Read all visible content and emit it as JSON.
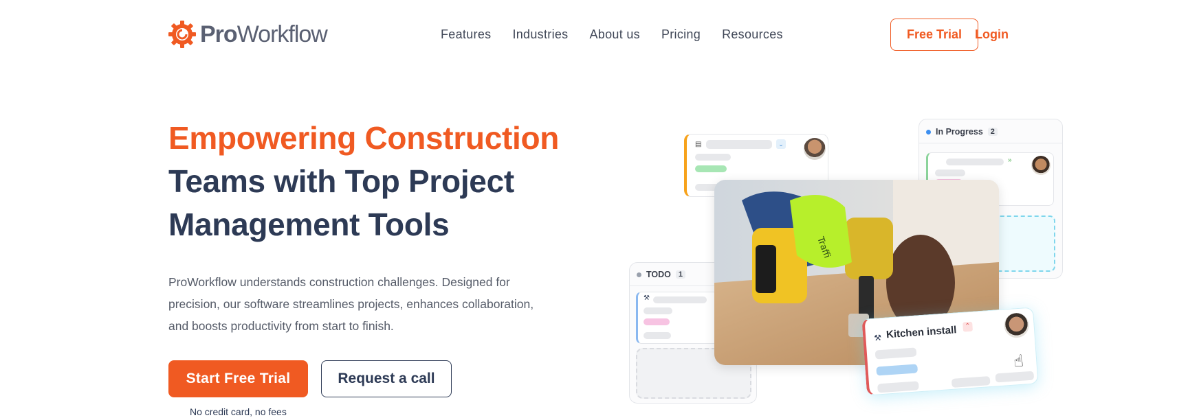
{
  "brand": {
    "name_bold": "Pro",
    "name_regular": "Workflow",
    "accent_color": "#f05a22",
    "text_color": "#2d3a55"
  },
  "nav": {
    "items": [
      "Features",
      "Industries",
      "About us",
      "Pricing",
      "Resources"
    ],
    "free_trial": "Free Trial",
    "login": "Login"
  },
  "hero": {
    "title_accent": "Empowering Construction",
    "title_rest": "Teams with Top Project Management Tools",
    "lead": "ProWorkflow understands construction challenges. Designed for precision, our software streamlines projects, enhances collaboration, and boosts productivity from start to finish.",
    "cta_primary": "Start Free Trial",
    "cta_secondary": "Request a call",
    "note": "No credit card, no fees"
  },
  "board": {
    "in_progress": {
      "label": "In Progress",
      "count": "2"
    },
    "todo": {
      "label": "TODO",
      "count": "1"
    },
    "kitchen_card": {
      "title": "Kitchen install"
    }
  }
}
